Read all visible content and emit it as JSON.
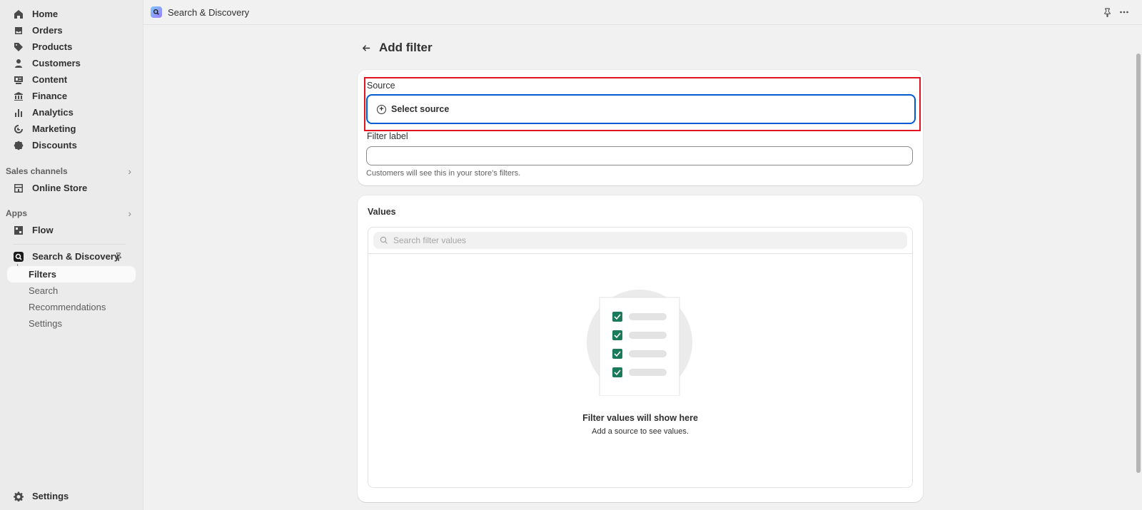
{
  "sidebar": {
    "items": [
      {
        "label": "Home",
        "icon": "home-icon"
      },
      {
        "label": "Orders",
        "icon": "orders-icon"
      },
      {
        "label": "Products",
        "icon": "tag-icon"
      },
      {
        "label": "Customers",
        "icon": "person-icon"
      },
      {
        "label": "Content",
        "icon": "content-icon"
      },
      {
        "label": "Finance",
        "icon": "bank-icon"
      },
      {
        "label": "Analytics",
        "icon": "bar-chart-icon"
      },
      {
        "label": "Marketing",
        "icon": "target-icon"
      },
      {
        "label": "Discounts",
        "icon": "discount-icon"
      }
    ],
    "sales_channels": {
      "heading": "Sales channels",
      "items": [
        {
          "label": "Online Store",
          "icon": "store-icon"
        }
      ]
    },
    "apps": {
      "heading": "Apps",
      "items": [
        {
          "label": "Flow",
          "icon": "flow-icon"
        }
      ]
    },
    "app": {
      "label": "Search & Discovery",
      "subitems": [
        "Filters",
        "Search",
        "Recommendations",
        "Settings"
      ],
      "active": "Filters"
    },
    "settings_label": "Settings"
  },
  "topbar": {
    "app_title": "Search & Discovery"
  },
  "page": {
    "title": "Add filter"
  },
  "form": {
    "source_label": "Source",
    "source_button": "Select source",
    "filter_label": "Filter label",
    "filter_label_value": "",
    "filter_help": "Customers will see this in your store’s filters."
  },
  "values": {
    "title": "Values",
    "search_placeholder": "Search filter values",
    "empty_title": "Filter values will show here",
    "empty_sub": "Add a source to see values."
  },
  "colors": {
    "accent": "#005bd3",
    "highlight": "#e0141e",
    "check": "#1a7a5a"
  }
}
